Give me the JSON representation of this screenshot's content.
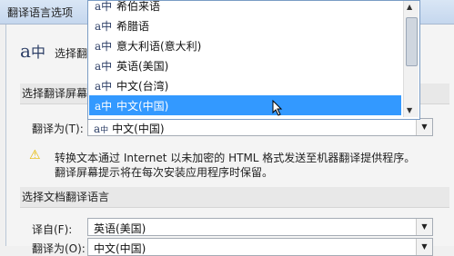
{
  "window": {
    "title": "翻译语言选项"
  },
  "header": {
    "logo_text": "a",
    "logo_sub": "中",
    "title": "选择翻"
  },
  "section1": {
    "title": "选择翻译屏幕提"
  },
  "translate_to": {
    "label": "翻译为(T):",
    "value": "中文(中国)"
  },
  "warning": {
    "line1": "转换文本通过 Internet 以未加密的 HTML 格式发送至机器翻译提供程序。",
    "line2": "翻译屏幕提示将在每次安装应用程序时保留。"
  },
  "section2": {
    "title": "选择文档翻译语言"
  },
  "translate_from": {
    "label": "译自(F):",
    "value": "英语(美国)"
  },
  "translate_to2": {
    "label": "翻译为(O):",
    "value": "中文(中国)"
  },
  "dropdown": {
    "items": [
      {
        "label": "希伯来语"
      },
      {
        "label": "希腊语"
      },
      {
        "label": "意大利语(意大利)"
      },
      {
        "label": "英语(美国)"
      },
      {
        "label": "中文(台湾)"
      },
      {
        "label": "中文(中国)",
        "selected": true
      }
    ],
    "selected_color": "#3399ff"
  },
  "icons": {
    "dropdown_arrow": "chevron-down-icon",
    "warning": "warning-icon",
    "language": "translate-icon"
  }
}
